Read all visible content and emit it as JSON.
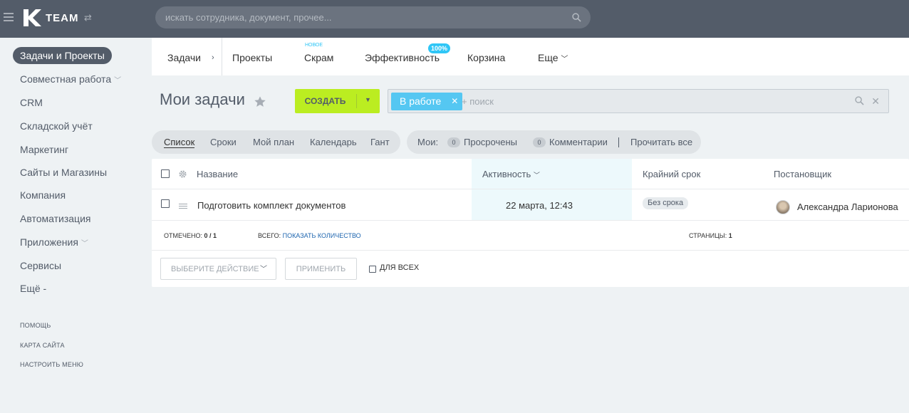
{
  "header": {
    "logo_text": "TEAM",
    "search_placeholder": "искать сотрудника, документ, прочее..."
  },
  "sidebar": {
    "items": [
      {
        "label": "Задачи и Проекты",
        "active": true
      },
      {
        "label": "Совместная работа",
        "has_chevron": true
      },
      {
        "label": "CRM"
      },
      {
        "label": "Складской учёт"
      },
      {
        "label": "Маркетинг"
      },
      {
        "label": "Сайты и Магазины"
      },
      {
        "label": "Компания"
      },
      {
        "label": "Автоматизация"
      },
      {
        "label": "Приложения",
        "has_chevron": true
      },
      {
        "label": "Сервисы"
      },
      {
        "label": "Ещё -"
      }
    ],
    "bottom": [
      "ПОМОЩЬ",
      "КАРТА САЙТА",
      "НАСТРОИТЬ МЕНЮ"
    ]
  },
  "tabs": {
    "first": "Задачи",
    "projects": "Проекты",
    "scrum": "Скрам",
    "scrum_badge": "НОВОЕ",
    "efficiency": "Эффективность",
    "efficiency_badge": "100%",
    "trash": "Корзина",
    "more": "Еще"
  },
  "title": {
    "text": "Мои задачи",
    "create_label": "СОЗДАТЬ"
  },
  "filter": {
    "tag": "В работе",
    "placeholder": "+ поиск"
  },
  "views": {
    "list": "Список",
    "deadlines": "Сроки",
    "plan": "Мой план",
    "calendar": "Календарь",
    "gantt": "Гант"
  },
  "counters": {
    "label": "Мои:",
    "overdue_count": "0",
    "overdue": "Просрочены",
    "comments_count": "0",
    "comments": "Комментарии",
    "read_all": "Прочитать все"
  },
  "grid": {
    "columns": {
      "name": "Название",
      "activity": "Активность",
      "deadline": "Крайний срок",
      "creator": "Постановщик"
    },
    "rows": [
      {
        "name": "Подготовить комплект документов",
        "activity": "22 марта, 12:43",
        "deadline": "Без срока",
        "creator": "Александра Ларионова"
      }
    ],
    "footer": {
      "selected_label": "ОТМЕЧЕНО:",
      "selected_value": "0 / 1",
      "total_label": "ВСЕГО:",
      "total_link": "ПОКАЗАТЬ КОЛИЧЕСТВО",
      "pages_label": "СТРАНИЦЫ:",
      "pages_value": "1"
    },
    "actions": {
      "select_placeholder": "ВЫБЕРИТЕ ДЕЙСТВИЕ",
      "apply": "ПРИМЕНИТЬ",
      "for_all": "ДЛЯ ВСЕХ"
    }
  },
  "colors": {
    "header_bg": "#535c69",
    "accent_green": "#bbed21",
    "filter_tag": "#55c7f2",
    "badge_blue": "#2fc6f6",
    "link": "#2067b0"
  }
}
